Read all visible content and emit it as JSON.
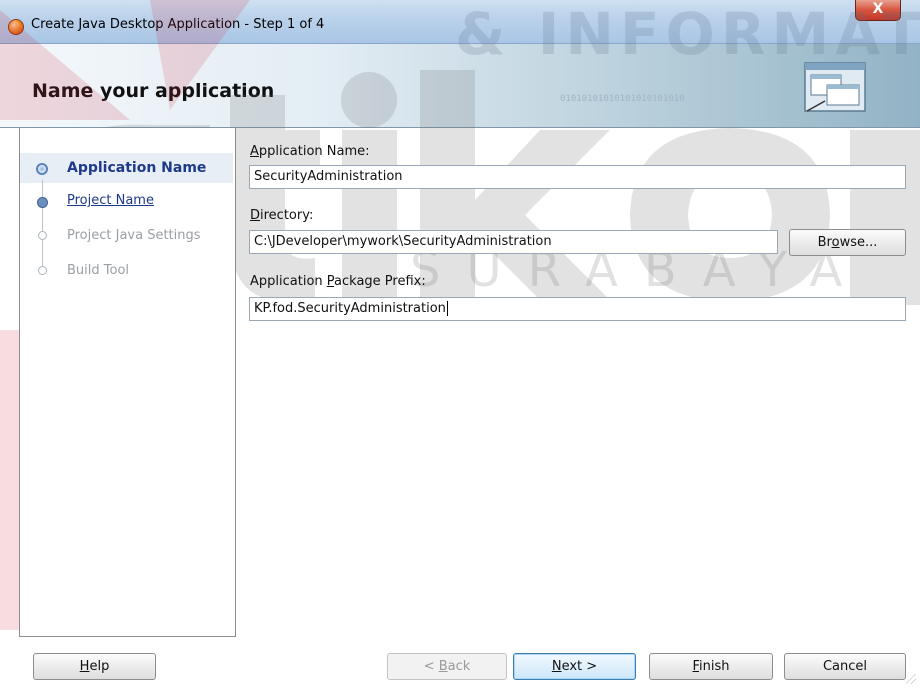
{
  "window": {
    "title": "Create Java Desktop Application - Step 1 of 4",
    "close_glyph": "X"
  },
  "header": {
    "title": "Name your application",
    "stripe_text": "01010101010101010101010",
    "graphic_icon": "windows-graphic-icon"
  },
  "watermark": {
    "top_text": "& INFORMATI",
    "bottom_text": "SURABAYA",
    "logo_text": "stikom"
  },
  "nav": {
    "items": [
      {
        "label": "Application Name",
        "state": "current"
      },
      {
        "label": "Project Name",
        "state": "link"
      },
      {
        "label": "Project Java Settings",
        "state": "disabled"
      },
      {
        "label": "Build Tool",
        "state": "disabled"
      }
    ]
  },
  "form": {
    "app_name_label_mn": "A",
    "app_name_label_rest": "pplication Name:",
    "app_name_value": "SecurityAdministration",
    "directory_label_mn": "D",
    "directory_label_rest": "irectory:",
    "directory_value": "C:\\JDeveloper\\mywork\\SecurityAdministration",
    "package_label_pre": "Application ",
    "package_label_mn": "P",
    "package_label_rest": "ackage Prefix:",
    "package_value": "KP.fod.SecurityAdministration",
    "browse_pre": "Br",
    "browse_mn": "o",
    "browse_rest": "wse..."
  },
  "buttons": {
    "help_mn": "H",
    "help_rest": "elp",
    "back_pre": "< ",
    "back_mn": "B",
    "back_rest": "ack",
    "next_mn": "N",
    "next_rest": "ext >",
    "finish_mn": "F",
    "finish_rest": "inish",
    "cancel": "Cancel"
  },
  "colors": {
    "accent_link": "#1f3a8a",
    "disabled_text": "#9aa0a6",
    "close_button": "#c2382a"
  }
}
